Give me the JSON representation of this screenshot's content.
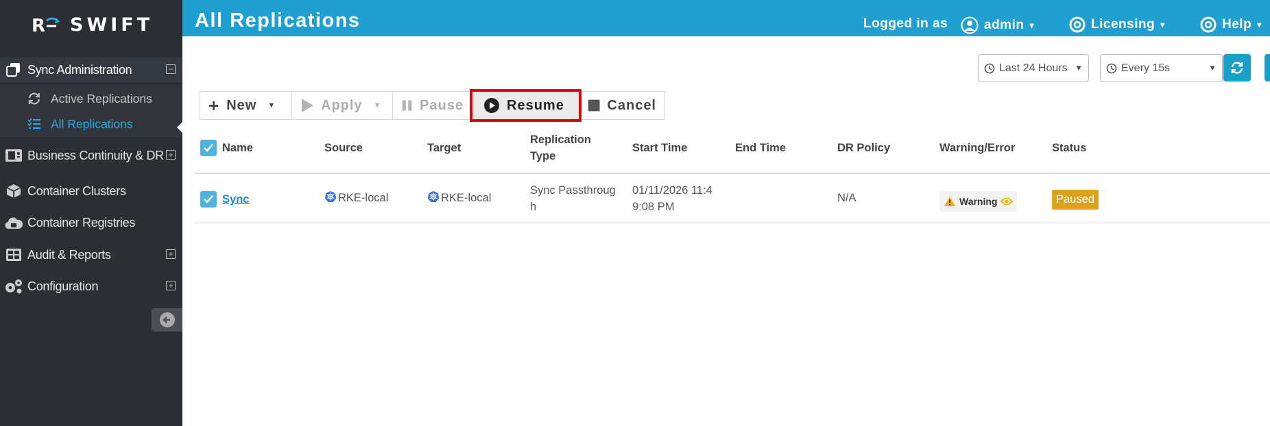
{
  "brand": {
    "name": "SWIFT"
  },
  "header": {
    "title": "All Replications",
    "logged_in_label": "Logged in as",
    "user": "admin",
    "licensing": "Licensing",
    "help": "Help"
  },
  "sidebar": {
    "sync_admin": "Sync Administration",
    "active_replications": "Active Replications",
    "all_replications": "All Replications",
    "business_continuity": "Business Continuity & DR",
    "container_clusters": "Container Clusters",
    "container_registries": "Container Registries",
    "audit_reports": "Audit & Reports",
    "configuration": "Configuration"
  },
  "controls": {
    "time_range": "Last 24 Hours",
    "refresh_interval": "Every 15s"
  },
  "toolbar": {
    "new_label": "New",
    "apply_label": "Apply",
    "pause_label": "Pause",
    "resume_label": "Resume",
    "cancel_label": "Cancel"
  },
  "table": {
    "columns": {
      "name": "Name",
      "source": "Source",
      "target": "Target",
      "replication_type_1": "Replication",
      "replication_type_2": "Type",
      "start_time": "Start Time",
      "end_time": "End Time",
      "dr_policy": "DR Policy",
      "warning_error": "Warning/Error",
      "status": "Status"
    },
    "rows": [
      {
        "name": "Sync",
        "source": "RKE-local",
        "target": "RKE-local",
        "type_line1": "Sync Passthroug",
        "type_line2": "h",
        "start_line1": "01/11/2026 11:4",
        "start_line2": "9:08 PM",
        "end_time": "",
        "dr_policy": "N/A",
        "warning": "Warning",
        "status": "Paused"
      }
    ]
  },
  "colors": {
    "header": "#1fa0d1",
    "sidebar": "#2b2e33",
    "accent": "#29a9e0",
    "status_paused": "#dca21c",
    "highlight": "#e00000"
  }
}
